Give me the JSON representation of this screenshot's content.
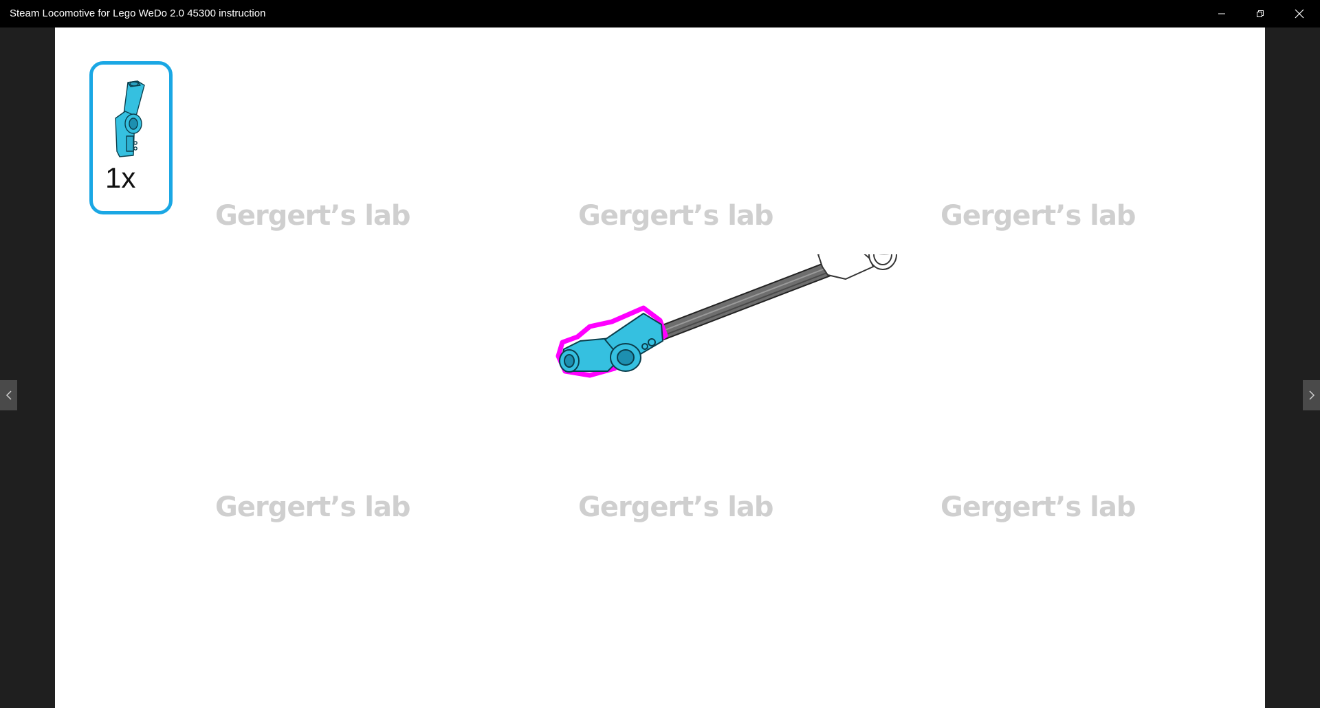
{
  "window": {
    "title": "Steam Locomotive for Lego WeDo 2.0 45300 instruction",
    "controls": [
      "minimize-icon",
      "restore-icon",
      "close-icon"
    ]
  },
  "step": {
    "parts": [
      {
        "quantity": "1x",
        "color": "#35c0e0",
        "icon": "angle-connector-part-icon"
      }
    ],
    "callout_border_color": "#1aa7e4",
    "highlight_color": "#ff00ff",
    "watermark": "Gergert’s lab"
  },
  "navigation": {
    "prev_icon": "chevron-left-icon",
    "next_icon": "chevron-right-icon"
  }
}
